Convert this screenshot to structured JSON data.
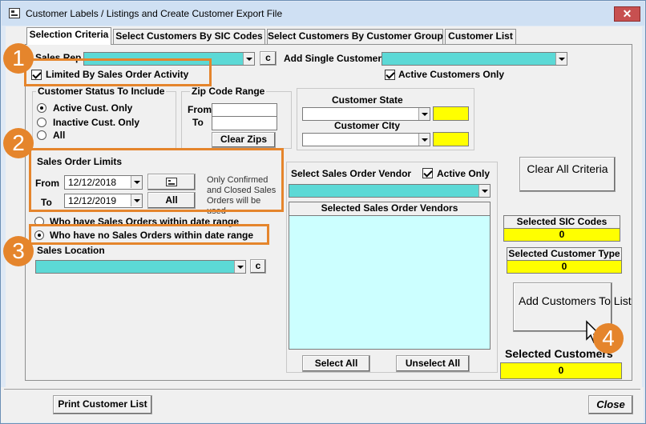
{
  "window": {
    "title": "Customer Labels /  Listings and Create Customer Export File",
    "close_symbol": "✕"
  },
  "tabs": [
    {
      "label": "Selection Criteria"
    },
    {
      "label": "Select Customers By SIC Codes"
    },
    {
      "label": "Select Customers By Customer Group"
    },
    {
      "label": "Customer List"
    }
  ],
  "sales_rep": {
    "label": "Sales Rep",
    "clear_label": "c"
  },
  "add_single_customer": {
    "label": "Add Single Customer"
  },
  "limited_by_sales_order": {
    "label": "Limited By Sales Order Activity",
    "checked": true
  },
  "active_customers_only": {
    "label": "Active Customers Only",
    "checked": true
  },
  "customer_status": {
    "title": "Customer Status To Include",
    "options": [
      {
        "label": "Active Cust. Only",
        "selected": true
      },
      {
        "label": "Inactive Cust. Only",
        "selected": false
      },
      {
        "label": "All",
        "selected": false
      }
    ]
  },
  "zip_range": {
    "title": "Zip Code Range",
    "from_label": "From",
    "to_label": "To",
    "clear_label": "Clear Zips"
  },
  "state_city": {
    "state_label": "Customer State",
    "city_label": "Customer CIty"
  },
  "sales_order_limits": {
    "title": "Sales Order Limits",
    "from_label": "From",
    "to_label": "To",
    "from_date": "12/12/2018",
    "to_date": "12/12/2019",
    "all_label": "All",
    "note": "Only Confirmed and Closed Sales Orders will be used"
  },
  "sales_order_options": [
    {
      "label": "Who have Sales Orders within date range",
      "selected": false
    },
    {
      "label": "Who have no Sales Orders within date range",
      "selected": true
    }
  ],
  "sales_location": {
    "label": "Sales Location",
    "clear_label": "c"
  },
  "vendor": {
    "label": "Select Sales Order Vendor",
    "active_only_label": "Active Only",
    "active_only_checked": true,
    "list_header": "Selected Sales Order Vendors",
    "select_all_label": "Select All",
    "unselect_all_label": "Unselect All"
  },
  "clear_all_label": "Clear All Criteria",
  "selected_sic": {
    "label": "Selected SIC Codes",
    "value": "0"
  },
  "selected_customer_type": {
    "label": "Selected Customer Type",
    "value": "0"
  },
  "add_customers_label": "Add Customers To List",
  "selected_customers": {
    "label": "Selected Customers",
    "value": "0"
  },
  "footer": {
    "print_label": "Print Customer List",
    "close_label": "Close"
  },
  "callouts": [
    "1",
    "2",
    "3",
    "4"
  ],
  "colors": {
    "accent_orange": "#e5852c",
    "cyan_field": "#5cd9d6",
    "yellow_field": "#ffff00",
    "vendor_list": "#ccffff"
  }
}
